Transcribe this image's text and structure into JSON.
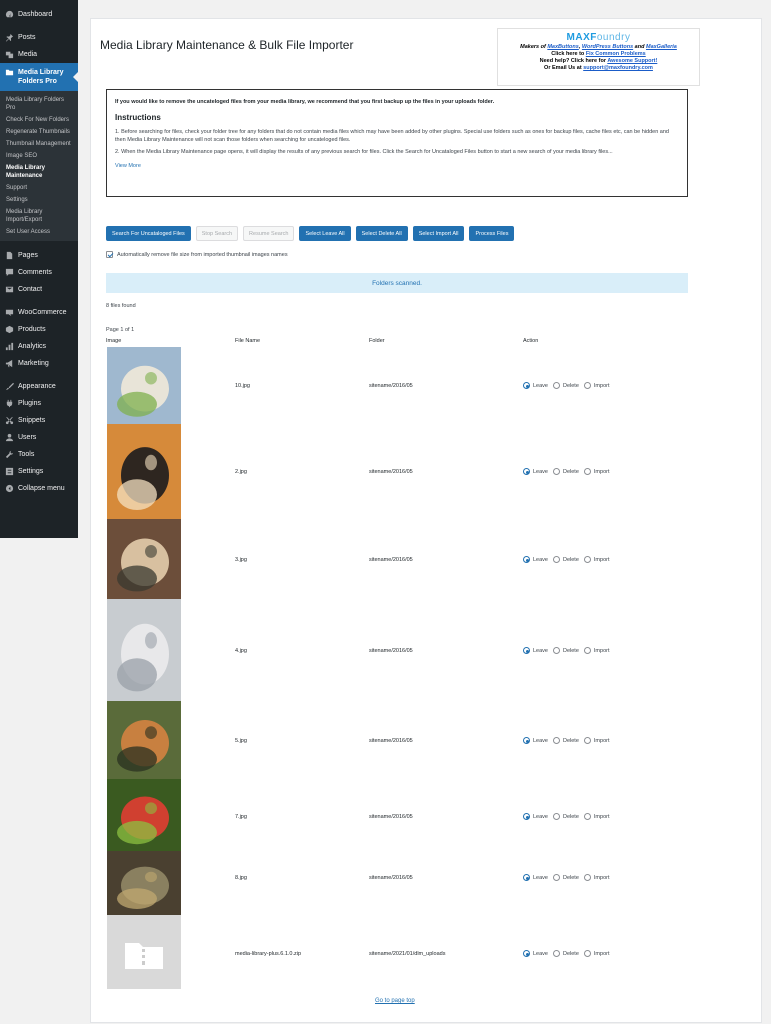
{
  "sidebar": {
    "top_items": [
      {
        "label": "Dashboard",
        "icon": "dashboard-icon"
      },
      {
        "label": "Posts",
        "icon": "pin-icon"
      },
      {
        "label": "Media",
        "icon": "media-icon"
      }
    ],
    "active_item": {
      "label": "Media Library Folders Pro",
      "icon": "folder-media-icon"
    },
    "submenu": [
      "Media Library Folders Pro",
      "Check For New Folders",
      "Regenerate Thumbnails",
      "Thumbnail Management",
      "Image SEO",
      "Media Library Maintenance",
      "Support",
      "Settings",
      "Media Library Import/Export",
      "Set User Access"
    ],
    "current_submenu": "Media Library Maintenance",
    "group2": [
      {
        "label": "Pages",
        "icon": "page-icon"
      },
      {
        "label": "Comments",
        "icon": "comment-icon"
      },
      {
        "label": "Contact",
        "icon": "mail-icon"
      }
    ],
    "group3": [
      {
        "label": "WooCommerce",
        "icon": "woo-icon"
      },
      {
        "label": "Products",
        "icon": "product-icon"
      },
      {
        "label": "Analytics",
        "icon": "chart-icon"
      },
      {
        "label": "Marketing",
        "icon": "megaphone-icon"
      }
    ],
    "group4": [
      {
        "label": "Appearance",
        "icon": "brush-icon"
      },
      {
        "label": "Plugins",
        "icon": "plug-icon"
      },
      {
        "label": "Snippets",
        "icon": "scissors-icon"
      },
      {
        "label": "Users",
        "icon": "user-icon"
      },
      {
        "label": "Tools",
        "icon": "wrench-icon"
      },
      {
        "label": "Settings",
        "icon": "settings-icon"
      },
      {
        "label": "Collapse menu",
        "icon": "collapse-icon"
      }
    ]
  },
  "page": {
    "title": "Media Library Maintenance & Bulk File Importer"
  },
  "maxfoundry": {
    "logo_bold": "MAXF",
    "logo_rest": "oundry",
    "makers_prefix": "Makers of ",
    "link1": "MaxButtons",
    "sep1": ", ",
    "link2": "WordPress Buttons",
    "sep2": " and ",
    "link3": "MaxGalleria",
    "click_prefix": "Click here to ",
    "click_link": "Fix Common Problems",
    "help_prefix": "Need help? Click here for ",
    "help_link": "Awesome Support!",
    "email_prefix": "Or Email Us at ",
    "email_link": "support@maxfoundry.com"
  },
  "notice": {
    "warning": "If you would like to remove the uncateloged files from your media library, we recommend that you first backup up the files in your uploads folder.",
    "heading": "Instructions",
    "p1": "1. Before searching for files, check your folder tree for any folders that do not contain media files which may have been added by other plugins. Special use folders such as ones for backup files, cache files etc, can be hidden and then Media Library Maintenance will not scan those folders when searching for uncateloged files.",
    "p2": "2. When the Media Library Maintenance page opens, it will display the results of any previous search for files. Click the Search for Uncataloged Files button to start a new search of your media library files...",
    "view_more": "View More"
  },
  "buttons": {
    "search": "Search For Uncataloged Files",
    "stop": "Stop Search",
    "resume": "Resume Search",
    "select_leave": "Select Leave All",
    "select_delete": "Select Delete All",
    "select_import": "Select Import All",
    "process": "Process Files"
  },
  "auto_remove_label": "Automatically remove file size from imported thumbnail images names",
  "status": "Folders scanned.",
  "files_found": "8 files found",
  "page_of": "Page 1 of 1",
  "table": {
    "headers": {
      "image": "Image",
      "file_name": "File Name",
      "folder": "Folder",
      "action": "Action"
    },
    "options": {
      "leave": "Leave",
      "delete": "Delete",
      "import": "Import"
    },
    "rows": [
      {
        "file": "10.jpg",
        "folder": "sitename/2016/05",
        "selected": "leave"
      },
      {
        "file": "2.jpg",
        "folder": "sitename/2016/05",
        "selected": "leave"
      },
      {
        "file": "3.jpg",
        "folder": "sitename/2016/05",
        "selected": "leave"
      },
      {
        "file": "4.jpg",
        "folder": "sitename/2016/05",
        "selected": "leave"
      },
      {
        "file": "5.jpg",
        "folder": "sitename/2016/05",
        "selected": "leave"
      },
      {
        "file": "7.jpg",
        "folder": "sitename/2016/05",
        "selected": "leave"
      },
      {
        "file": "8.jpg",
        "folder": "sitename/2016/05",
        "selected": "leave"
      },
      {
        "file": "media-library-plus.6.1.0.zip",
        "folder": "sitename/2021/01/dlm_uploads",
        "selected": "leave"
      }
    ]
  },
  "goto_top": "Go to page top"
}
